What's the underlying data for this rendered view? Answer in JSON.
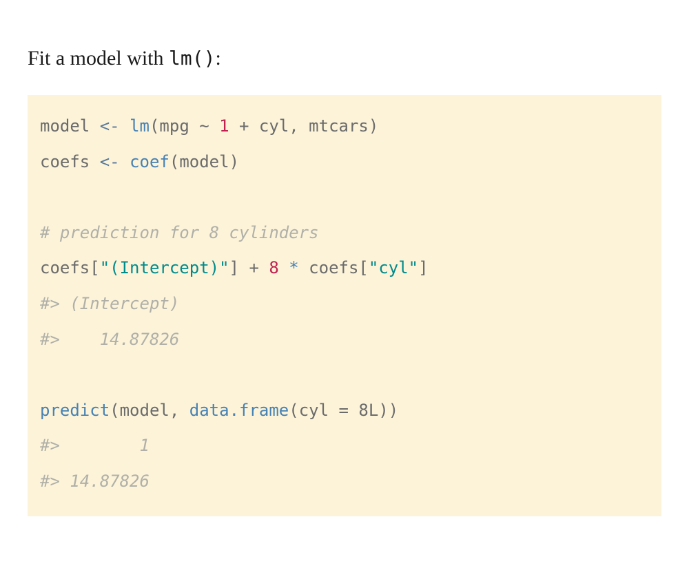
{
  "heading": {
    "prefix": "Fit a model with ",
    "code": "lm()",
    "suffix": ":"
  },
  "code": {
    "line1": {
      "name1": "model ",
      "assign": "<-",
      "space1": " ",
      "func": "lm",
      "paren_open": "(",
      "arg1": "mpg ",
      "tilde": "~",
      "space2": " ",
      "num": "1",
      "space3": " ",
      "plus": "+",
      "rest": " cyl, mtcars",
      "paren_close": ")"
    },
    "line2": {
      "name1": "coefs ",
      "assign": "<-",
      "space1": " ",
      "func": "coef",
      "paren_open": "(",
      "arg": "model",
      "paren_close": ")"
    },
    "blank1": "",
    "line3_comment": "# prediction for 8 cylinders",
    "line4": {
      "name1": "coefs[",
      "str1": "\"(Intercept)\"",
      "mid1": "] ",
      "plus": "+",
      "space1": " ",
      "num": "8",
      "space2": " ",
      "star": "*",
      "mid2": " coefs[",
      "str2": "\"cyl\"",
      "close": "]"
    },
    "line5_output": "#> (Intercept) ",
    "line6_output": "#>    14.87826",
    "blank2": "",
    "line7": {
      "func1": "predict",
      "paren1": "(",
      "arg1": "model, ",
      "func2": "data.frame",
      "paren2": "(",
      "arg2": "cyl ",
      "eq": "=",
      "rest": " 8L))"
    },
    "line8_output": "#>        1 ",
    "line9_output": "#> 14.87826"
  }
}
